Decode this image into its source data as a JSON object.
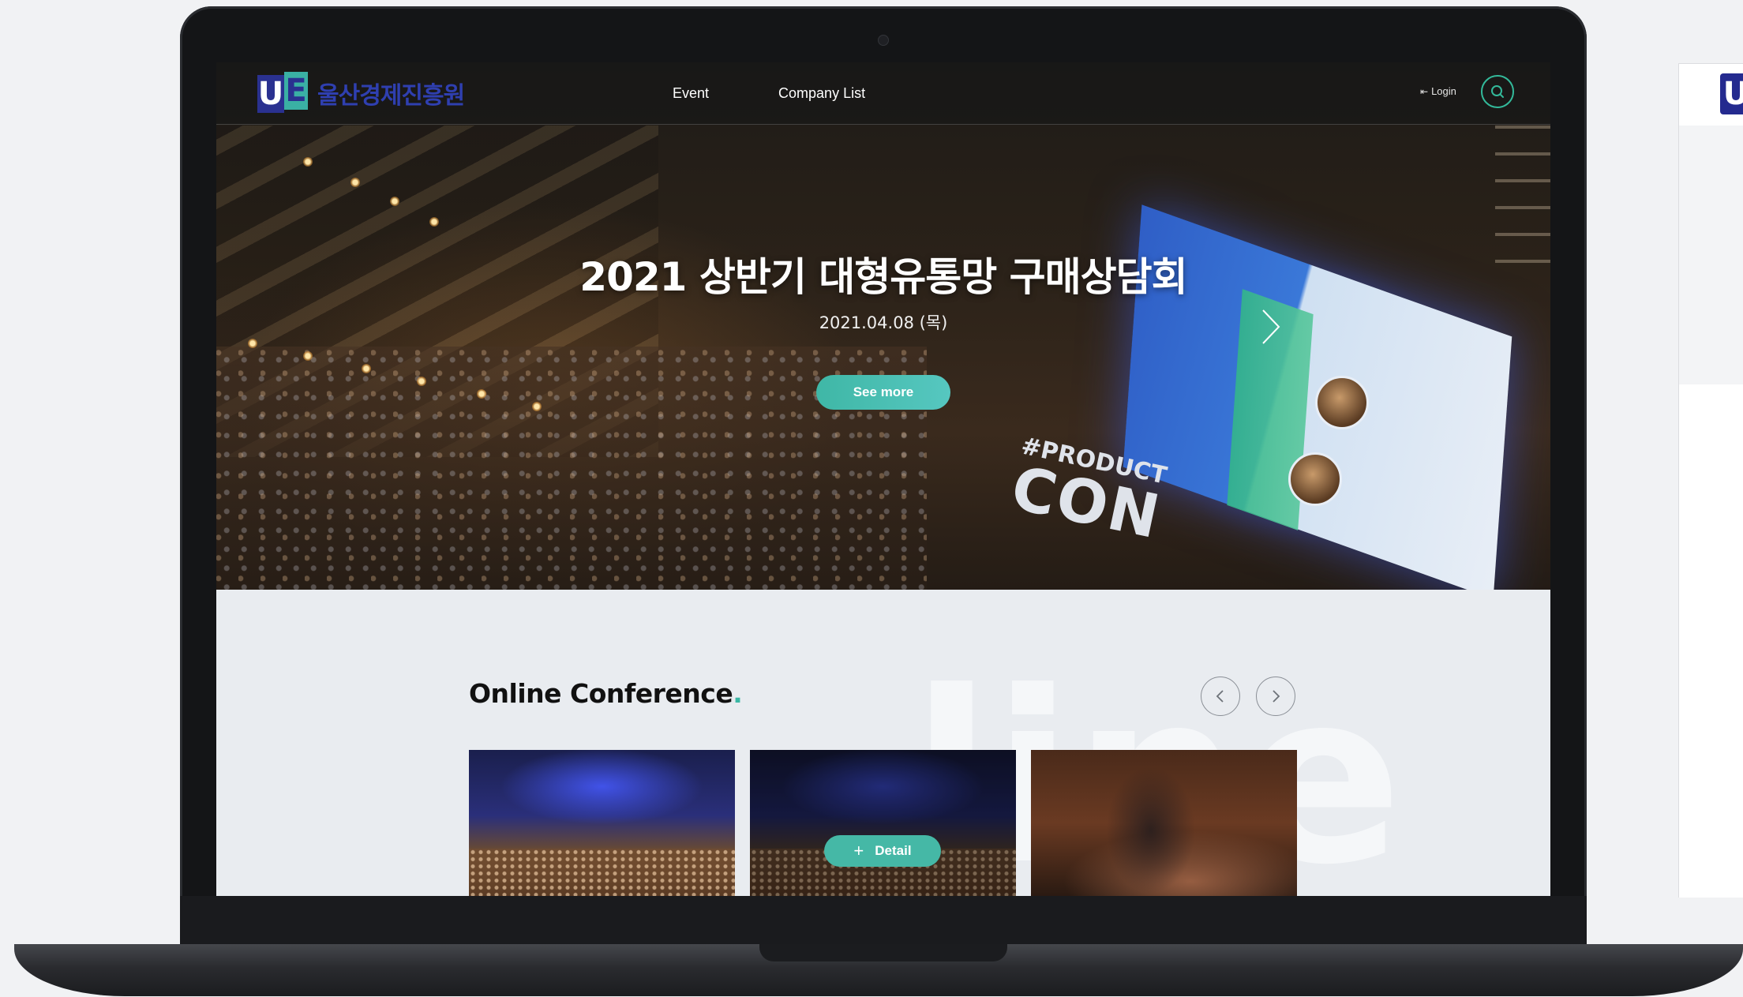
{
  "site": {
    "logo_text": "울산경제진흥원",
    "logo_mark": {
      "u": "U",
      "e": "E"
    }
  },
  "nav": {
    "items": [
      {
        "label": "Event"
      },
      {
        "label": "Company List"
      }
    ],
    "login_label": "Login"
  },
  "hero": {
    "title": "2021 상반기 대형유통망 구매상담회",
    "date": "2021.04.08 (목)",
    "cta_label": "See more",
    "stage_text_small": "#PRODUCT",
    "stage_text_big": "CON"
  },
  "conference": {
    "title": "Online Conference",
    "title_dot": ".",
    "watermark": "line",
    "detail_label": "Detail"
  },
  "colors": {
    "accent": "#3ab7a4",
    "brand_blue": "#2a3190",
    "background": "#e9ecf0"
  },
  "icons": {
    "login": "login-icon",
    "search": "search-icon",
    "next": "chevron-right-icon",
    "prev": "chevron-left-icon",
    "plus": "plus-icon"
  }
}
